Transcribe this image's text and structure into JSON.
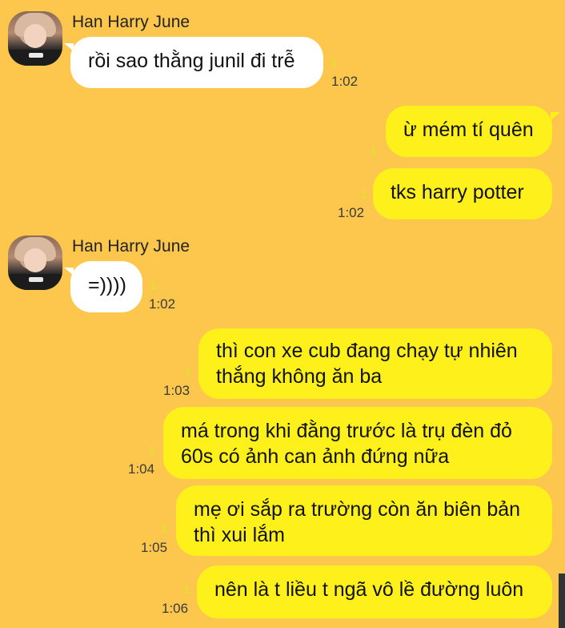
{
  "colors": {
    "background": "#fdc74e",
    "incoming_bubble": "#ffffff",
    "outgoing_bubble": "#fef01b",
    "unread_marker": "#e0e22b"
  },
  "messages": [
    {
      "sender": "Han Harry June",
      "text_lines": [
        "rồi sao thằng junil đi trễ"
      ],
      "unread": "1",
      "time": "1:02"
    },
    {
      "text_lines": [
        "ừ mém tí quên"
      ],
      "unread": "1",
      "time": ""
    },
    {
      "text_lines": [
        "tks harry potter"
      ],
      "unread": "1",
      "time": "1:02"
    },
    {
      "sender": "Han Harry June",
      "text_lines": [
        "=))))"
      ],
      "unread": "1",
      "time": "1:02"
    },
    {
      "text_lines": [
        "thì con xe cub đang chạy tự nhiên",
        "thắng không ăn ba"
      ],
      "unread": "1",
      "time": "1:03"
    },
    {
      "text_lines": [
        "má trong khi đằng trước là trụ đèn đỏ",
        "60s có ảnh can ảnh đứng nữa"
      ],
      "unread": "1",
      "time": "1:04"
    },
    {
      "text_lines": [
        "mẹ ơi sắp ra trường còn ăn biên bản",
        "thì xui lắm"
      ],
      "unread": "1",
      "time": "1:05"
    },
    {
      "text_lines": [
        "nên là t liều t ngã vô lề đường luôn"
      ],
      "unread": "1",
      "time": "1:06"
    }
  ]
}
